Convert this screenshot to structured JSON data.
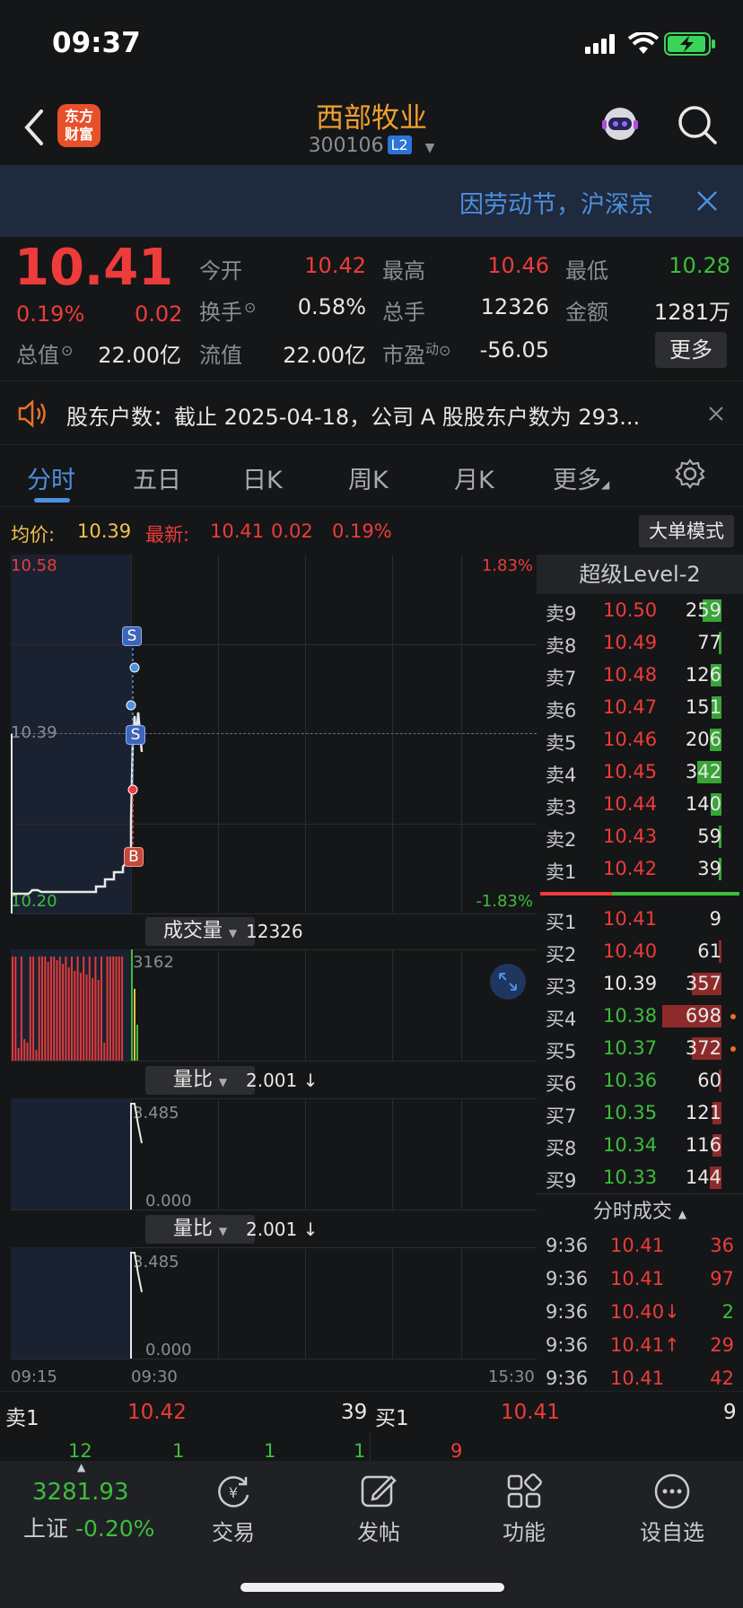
{
  "status_bar": {
    "time": "09:37"
  },
  "header": {
    "stock_name": "西部牧业",
    "stock_code": "300106",
    "level_badge": "L2",
    "logo_text_1": "东方",
    "logo_text_2": "财富"
  },
  "banner": {
    "text": "因劳动节，沪深京"
  },
  "quote": {
    "price": "10.41",
    "change_pct": "0.19%",
    "change": "0.02",
    "open_label": "今开",
    "open": "10.42",
    "high_label": "最高",
    "high": "10.46",
    "low_label": "最低",
    "low": "10.28",
    "turnover_label": "换手",
    "turnover": "0.58%",
    "volume_label": "总手",
    "volume": "12326",
    "amount_label": "金额",
    "amount": "1281万",
    "mktcap_label": "总值",
    "mktcap": "22.00亿",
    "float_label": "流值",
    "float": "22.00亿",
    "pe_label": "市盈",
    "pe_sup": "动",
    "pe": "-56.05",
    "more_button": "更多"
  },
  "announcement": {
    "text": "股东户数：截止 2025-04-18，公司 A 股股东户数为 293..."
  },
  "tabs": [
    "分时",
    "五日",
    "日K",
    "周K",
    "月K",
    "更多"
  ],
  "info_line": {
    "avg_label": "均价:",
    "avg": "10.39",
    "latest_label": "最新:",
    "latest": "10.41",
    "latest_change": "0.02",
    "latest_pct": "0.19%",
    "mode_button": "大单模式"
  },
  "chart": {
    "y_high": "10.58",
    "y_mid": "10.39",
    "y_low": "10.20",
    "pct_high": "1.83%",
    "pct_low": "-1.83%",
    "time_start": "09:15",
    "time_mid": "09:30",
    "time_end": "15:30",
    "markers": [
      "S",
      "S",
      "B"
    ]
  },
  "volume_panel": {
    "label": "成交量",
    "value": "12326",
    "scale_max": "3162"
  },
  "ratio_panel_1": {
    "label": "量比",
    "value": "2.001 ↓",
    "scale_max": "3.485",
    "scale_min": "0.000"
  },
  "ratio_panel_2": {
    "label": "量比",
    "value": "2.001 ↓",
    "scale_max": "3.485",
    "scale_min": "0.000"
  },
  "order_book": {
    "title": "超级Level-2",
    "asks": [
      {
        "label": "卖9",
        "price": "10.50",
        "vol": "259",
        "bar": 0.35,
        "bar_color": "#3cbe3c"
      },
      {
        "label": "卖8",
        "price": "10.49",
        "vol": "77",
        "bar": 0.05,
        "bar_color": "#3cbe3c"
      },
      {
        "label": "卖7",
        "price": "10.48",
        "vol": "126",
        "bar": 0.2,
        "bar_color": "#3cbe3c"
      },
      {
        "label": "卖6",
        "price": "10.47",
        "vol": "151",
        "bar": 0.18,
        "bar_color": "#3cbe3c"
      },
      {
        "label": "卖5",
        "price": "10.46",
        "vol": "206",
        "bar": 0.22,
        "bar_color": "#3cbe3c"
      },
      {
        "label": "卖4",
        "price": "10.45",
        "vol": "342",
        "bar": 0.45,
        "bar_color": "#3cbe3c"
      },
      {
        "label": "卖3",
        "price": "10.44",
        "vol": "140",
        "bar": 0.2,
        "bar_color": "#3cbe3c"
      },
      {
        "label": "卖2",
        "price": "10.43",
        "vol": "59",
        "bar": 0.04,
        "bar_color": "#3cbe3c"
      },
      {
        "label": "卖1",
        "price": "10.42",
        "vol": "39",
        "bar": 0.03,
        "bar_color": "#3cbe3c"
      }
    ],
    "bids": [
      {
        "label": "买1",
        "price": "10.41",
        "vol": "9",
        "price_color": "#ee3b3b",
        "bar": 0.0,
        "dot": ""
      },
      {
        "label": "买2",
        "price": "10.40",
        "vol": "61",
        "price_color": "#ee3b3b",
        "bar": 0.05,
        "dot": ""
      },
      {
        "label": "买3",
        "price": "10.39",
        "vol": "357",
        "price_color": "#e8e8e8",
        "bar": 0.5,
        "dot": ""
      },
      {
        "label": "买4",
        "price": "10.38",
        "vol": "698",
        "price_color": "#3cbe3c",
        "bar": 1.0,
        "dot": "#e8702a"
      },
      {
        "label": "买5",
        "price": "10.37",
        "vol": "372",
        "price_color": "#3cbe3c",
        "bar": 0.5,
        "dot": "#e8702a"
      },
      {
        "label": "买6",
        "price": "10.36",
        "vol": "60",
        "price_color": "#3cbe3c",
        "bar": 0.05,
        "dot": ""
      },
      {
        "label": "买7",
        "price": "10.35",
        "vol": "121",
        "price_color": "#3cbe3c",
        "bar": 0.15,
        "dot": ""
      },
      {
        "label": "买8",
        "price": "10.34",
        "vol": "116",
        "price_color": "#3cbe3c",
        "bar": 0.15,
        "dot": ""
      },
      {
        "label": "买9",
        "price": "10.33",
        "vol": "144",
        "price_color": "#3cbe3c",
        "bar": 0.2,
        "dot": ""
      }
    ]
  },
  "ticks": {
    "title": "分时成交",
    "rows": [
      {
        "time": "9:36",
        "price": "10.41",
        "vol": "36",
        "price_color": "#ee3b3b",
        "vol_color": "#ee3b3b"
      },
      {
        "time": "9:36",
        "price": "10.41",
        "vol": "97",
        "price_color": "#ee3b3b",
        "vol_color": "#ee3b3b"
      },
      {
        "time": "9:36",
        "price": "10.40↓",
        "vol": "2",
        "price_color": "#ee3b3b",
        "vol_color": "#3cbe3c"
      },
      {
        "time": "9:36",
        "price": "10.41↑",
        "vol": "29",
        "price_color": "#ee3b3b",
        "vol_color": "#ee3b3b"
      },
      {
        "time": "9:36",
        "price": "10.41",
        "vol": "42",
        "price_color": "#ee3b3b",
        "vol_color": "#ee3b3b"
      }
    ]
  },
  "bottom_book": {
    "ask_label": "卖1",
    "ask_price": "10.42",
    "ask_vol": "39",
    "bid_label": "买1",
    "bid_price": "10.41",
    "bid_vol": "9",
    "ask_queue": [
      "12",
      "1",
      "1",
      "1"
    ],
    "bid_queue": [
      "9"
    ]
  },
  "tabbar": {
    "index_value": "3281.93",
    "index_name": "上证",
    "index_change": "-0.20%",
    "items": [
      "交易",
      "发帖",
      "功能",
      "设自选"
    ]
  },
  "colors": {
    "up": "#ee3b3b",
    "down": "#3cbe3c",
    "accent": "#f0a030",
    "link": "#4d8fe0"
  }
}
